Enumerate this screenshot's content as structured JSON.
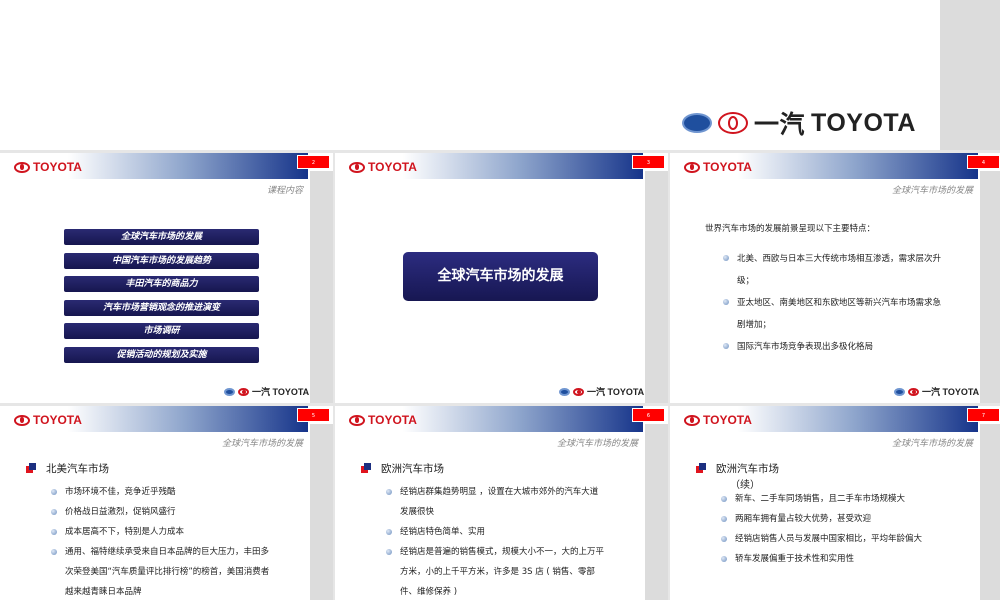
{
  "cover": {
    "brand_cn": "一汽",
    "brand": "TOYOTA"
  },
  "slides": [
    {
      "page": "2",
      "logo": "TOYOTA",
      "subtitle": "课程内容",
      "footer": "一汽 TOYOTA",
      "menu": [
        "全球汽车市场的发展",
        "中国汽车市场的发展趋势",
        "丰田汽车的商品力",
        "汽车市场营销观念的推进演变",
        "市场调研",
        "促销活动的规划及实施"
      ]
    },
    {
      "page": "3",
      "logo": "TOYOTA",
      "title": "全球汽车市场的发展",
      "footer": "一汽 TOYOTA"
    },
    {
      "page": "4",
      "logo": "TOYOTA",
      "subtitle": "全球汽车市场的发展",
      "footer": "一汽 TOYOTA",
      "intro": "世界汽车市场的发展前景呈现以下主要特点：",
      "bullets": [
        "北美、西欧与日本三大传统市场相互渗透，需求层次升级；",
        "亚太地区、南美地区和东欧地区等新兴汽车市场需求急剧增加；",
        "国际汽车市场竞争表现出多极化格局"
      ]
    },
    {
      "page": "5",
      "logo": "TOYOTA",
      "subtitle": "全球汽车市场的发展",
      "heading": "北美汽车市场",
      "bullets": [
        "市场环境不佳，竞争近乎残酷",
        "价格战日益激烈，促销风盛行",
        "成本居高不下，特别是人力成本",
        "通用、福特继续承受来自日本品牌的巨大压力，丰田多次荣登美国“汽车质量评比排行榜”的榜首，美国消费者越来越青睐日本品牌"
      ]
    },
    {
      "page": "6",
      "logo": "TOYOTA",
      "subtitle": "全球汽车市场的发展",
      "heading": "欧洲汽车市场",
      "bullets": [
        "经销店群集趋势明显 ，设置在大城市郊外的汽车大道发展很快",
        "经销店特色简单、实用",
        "经销店是普遍的销售模式，规模大小不一，大的上万平方米，小的上千平方米，许多是 3S 店 ( 销售、零部件、维修保养 )"
      ]
    },
    {
      "page": "7",
      "logo": "TOYOTA",
      "subtitle": "全球汽车市场的发展",
      "heading": "欧洲汽车市场",
      "heading2": "（续）",
      "bullets": [
        "  新车、二手车同场销售，且二手车市场规模大",
        "两厢车拥有量占较大优势，甚受欢迎",
        "经销店销售人员与发展中国家相比，平均年龄偏大",
        "轿车发展偏重于技术性和实用性"
      ]
    }
  ],
  "colors": {
    "red": "#d0141e",
    "navy": "#16348a"
  }
}
